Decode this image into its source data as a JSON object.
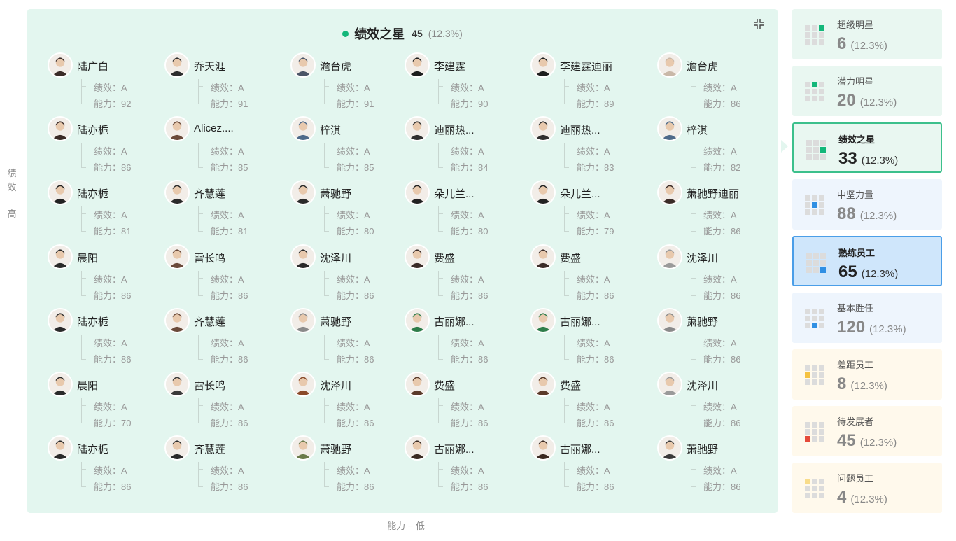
{
  "y_axis": {
    "chars": [
      "绩",
      "效"
    ],
    "level": "高"
  },
  "x_axis": {
    "label": "能力 − 低"
  },
  "panel": {
    "title": "绩效之星",
    "count": "45",
    "percent": "(12.3%)",
    "collapse_icon": "collapse-icon",
    "perf_prefix": "绩效：",
    "ability_prefix": "能力："
  },
  "employees": [
    {
      "name": "陆广白",
      "perf": "A",
      "ability": "92",
      "avatar_color": "#3b2c28"
    },
    {
      "name": "乔天涯",
      "perf": "A",
      "ability": "91",
      "avatar_color": "#2d2d2d"
    },
    {
      "name": "澹台虎",
      "perf": "A",
      "ability": "91",
      "avatar_color": "#4b5567"
    },
    {
      "name": "李建霆",
      "perf": "A",
      "ability": "90",
      "avatar_color": "#1e1e1e"
    },
    {
      "name": "李建霆迪丽",
      "perf": "A",
      "ability": "89",
      "avatar_color": "#1e1e1e"
    },
    {
      "name": "澹台虎",
      "perf": "A",
      "ability": "86",
      "avatar_color": "#c9b8a8"
    },
    {
      "name": "陆亦栀",
      "perf": "A",
      "ability": "86",
      "avatar_color": "#3a2a26"
    },
    {
      "name": "Alicez....",
      "perf": "A",
      "ability": "85",
      "avatar_color": "#6a4a3a"
    },
    {
      "name": "梓淇",
      "perf": "A",
      "ability": "85",
      "avatar_color": "#4e6a8a"
    },
    {
      "name": "迪丽热...",
      "perf": "A",
      "ability": "84",
      "avatar_color": "#2f2f2f"
    },
    {
      "name": "迪丽热...",
      "perf": "A",
      "ability": "83",
      "avatar_color": "#2f2f2f"
    },
    {
      "name": "梓淇",
      "perf": "A",
      "ability": "82",
      "avatar_color": "#4e6a8a"
    },
    {
      "name": "陆亦栀",
      "perf": "A",
      "ability": "81",
      "avatar_color": "#222222"
    },
    {
      "name": "齐慧莲",
      "perf": "A",
      "ability": "81",
      "avatar_color": "#2a2a2a"
    },
    {
      "name": "萧驰野",
      "perf": "A",
      "ability": "80",
      "avatar_color": "#2a2a2a"
    },
    {
      "name": "朵儿兰...",
      "perf": "A",
      "ability": "80",
      "avatar_color": "#222222"
    },
    {
      "name": "朵儿兰...",
      "perf": "A",
      "ability": "79",
      "avatar_color": "#222222"
    },
    {
      "name": "萧驰野迪丽",
      "perf": "A",
      "ability": "86",
      "avatar_color": "#3b2c28"
    },
    {
      "name": "晨阳",
      "perf": "A",
      "ability": "86",
      "avatar_color": "#2a2a2a"
    },
    {
      "name": "雷长鸣",
      "perf": "A",
      "ability": "86",
      "avatar_color": "#6a4a3a"
    },
    {
      "name": "沈泽川",
      "perf": "A",
      "ability": "86",
      "avatar_color": "#2a2a2a"
    },
    {
      "name": "费盛",
      "perf": "A",
      "ability": "86",
      "avatar_color": "#3b2c28"
    },
    {
      "name": "费盛",
      "perf": "A",
      "ability": "86",
      "avatar_color": "#3b2c28"
    },
    {
      "name": "沈泽川",
      "perf": "A",
      "ability": "86",
      "avatar_color": "#9a9a9a"
    },
    {
      "name": "陆亦栀",
      "perf": "A",
      "ability": "86",
      "avatar_color": "#2a2a2a"
    },
    {
      "name": "齐慧莲",
      "perf": "A",
      "ability": "86",
      "avatar_color": "#6a4a3a"
    },
    {
      "name": "萧驰野",
      "perf": "A",
      "ability": "86",
      "avatar_color": "#8a8a8a"
    },
    {
      "name": "古丽娜...",
      "perf": "A",
      "ability": "86",
      "avatar_color": "#2e7d4a"
    },
    {
      "name": "古丽娜...",
      "perf": "A",
      "ability": "86",
      "avatar_color": "#2e7d4a"
    },
    {
      "name": "萧驰野",
      "perf": "A",
      "ability": "86",
      "avatar_color": "#8a8a8a"
    },
    {
      "name": "晨阳",
      "perf": "A",
      "ability": "70",
      "avatar_color": "#2a2a2a"
    },
    {
      "name": "雷长鸣",
      "perf": "A",
      "ability": "86",
      "avatar_color": "#3a3a3a"
    },
    {
      "name": "沈泽川",
      "perf": "A",
      "ability": "86",
      "avatar_color": "#8a4a2a"
    },
    {
      "name": "费盛",
      "perf": "A",
      "ability": "86",
      "avatar_color": "#5a3a2a"
    },
    {
      "name": "费盛",
      "perf": "A",
      "ability": "86",
      "avatar_color": "#5a3a2a"
    },
    {
      "name": "沈泽川",
      "perf": "A",
      "ability": "86",
      "avatar_color": "#9a9a9a"
    },
    {
      "name": "陆亦栀",
      "perf": "A",
      "ability": "86",
      "avatar_color": "#2a2a2a"
    },
    {
      "name": "齐慧莲",
      "perf": "A",
      "ability": "86",
      "avatar_color": "#2a2a2a"
    },
    {
      "name": "萧驰野",
      "perf": "A",
      "ability": "86",
      "avatar_color": "#6a7a4a"
    },
    {
      "name": "古丽娜...",
      "perf": "A",
      "ability": "86",
      "avatar_color": "#3a2a22"
    },
    {
      "name": "古丽娜...",
      "perf": "A",
      "ability": "86",
      "avatar_color": "#3a2a22"
    },
    {
      "name": "萧驰野",
      "perf": "A",
      "ability": "86",
      "avatar_color": "#3a3a3a"
    }
  ],
  "categories": [
    {
      "label": "超级明星",
      "count": "6",
      "pct": "(12.3%)",
      "bg": "#e9f7f1",
      "highlight": 2,
      "hl_color": "#13b77a",
      "active": false
    },
    {
      "label": "潜力明星",
      "count": "20",
      "pct": "(12.3%)",
      "bg": "#e9f7f1",
      "highlight": 1,
      "hl_color": "#13b77a",
      "active": false
    },
    {
      "label": "绩效之星",
      "count": "33",
      "pct": "(12.3%)",
      "bg": "#e9f7f1",
      "highlight": 5,
      "hl_color": "#13b77a",
      "active": true,
      "border": "#3cc08c"
    },
    {
      "label": "中坚力量",
      "count": "88",
      "pct": "(12.3%)",
      "bg": "#eef5fd",
      "highlight": 4,
      "hl_color": "#2f8fe3",
      "active": false
    },
    {
      "label": "熟练员工",
      "count": "65",
      "pct": "(12.3%)",
      "bg": "#cfe6fb",
      "highlight": 8,
      "hl_color": "#2f8fe3",
      "active": true,
      "border": "#4a9ee8"
    },
    {
      "label": "基本胜任",
      "count": "120",
      "pct": "(12.3%)",
      "bg": "#eef5fd",
      "highlight": 7,
      "hl_color": "#2f8fe3",
      "active": false
    },
    {
      "label": "差距员工",
      "count": "8",
      "pct": "(12.3%)",
      "bg": "#fff9ec",
      "highlight": 3,
      "hl_color": "#f5c242",
      "active": false
    },
    {
      "label": "待发展者",
      "count": "45",
      "pct": "(12.3%)",
      "bg": "#fff9ec",
      "highlight": 6,
      "hl_color": "#e54a3a",
      "active": false
    },
    {
      "label": "问题员工",
      "count": "4",
      "pct": "(12.3%)",
      "bg": "#fff9ec",
      "highlight": 0,
      "hl_color": "#f8dc8a",
      "active": false
    }
  ]
}
